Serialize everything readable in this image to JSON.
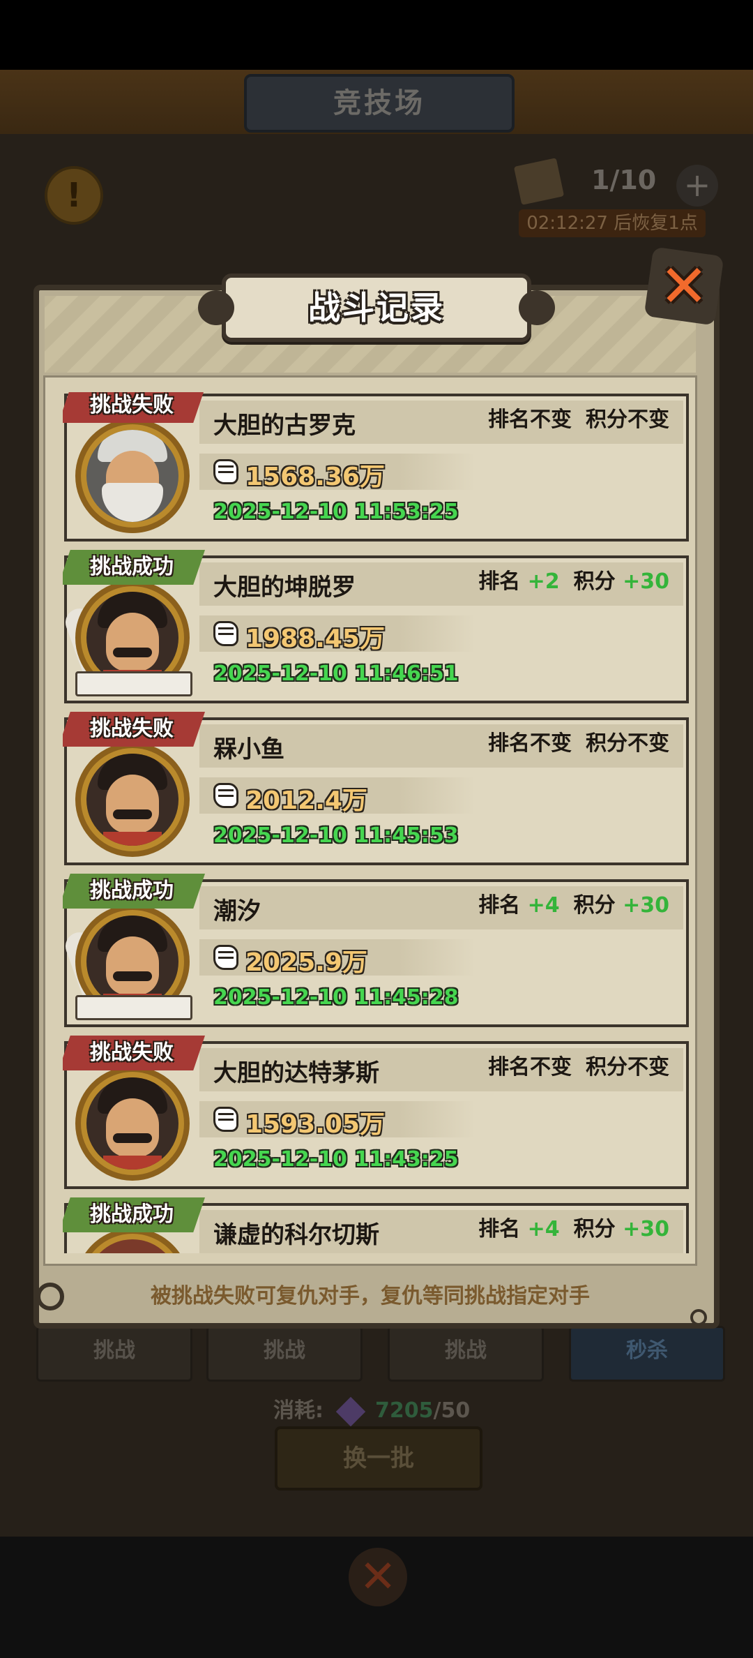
{
  "background": {
    "title": "竞技场",
    "info_icon_glyph": "!",
    "tickets": "1/10",
    "plus_glyph": "+",
    "recover_text": "02:12:27 后恢复1点",
    "buttons": [
      "挑战",
      "挑战",
      "挑战",
      "秒杀"
    ],
    "cost_label": "消耗:",
    "cost_have": "7205",
    "cost_need": "/50",
    "swap_label": "换一批",
    "close_glyph": "✕"
  },
  "modal": {
    "title": "战斗记录",
    "close_glyph": "✕",
    "footer": "被挑战失败可复仇对手，复仇等同挑战指定对手"
  },
  "records": [
    {
      "badge": "挑战失败",
      "outcome": "fail",
      "name": "大胆的古罗克",
      "result": "排名不变",
      "result2": "积分不变",
      "power": "1568.36万",
      "time": "2025-12-10 11:53:25",
      "avatar": "old-bearded-man"
    },
    {
      "badge": "挑战成功",
      "outcome": "win",
      "name": "大胆的坤脱罗",
      "rank_label": "排名",
      "rank_delta": "+2",
      "score_label": "积分",
      "score_delta": "+30",
      "power": "1988.45万",
      "time": "2025-12-10 11:46:51",
      "avatar": "mustache-man-quill"
    },
    {
      "badge": "挑战失败",
      "outcome": "fail",
      "name": "槑小鱼",
      "result": "排名不变",
      "result2": "积分不变",
      "power": "2012.4万",
      "time": "2025-12-10 11:45:53",
      "avatar": "mustache-man"
    },
    {
      "badge": "挑战成功",
      "outcome": "win",
      "name": "潮汐",
      "rank_label": "排名",
      "rank_delta": "+4",
      "score_label": "积分",
      "score_delta": "+30",
      "power": "2025.9万",
      "time": "2025-12-10 11:45:28",
      "avatar": "mustache-man-quill"
    },
    {
      "badge": "挑战失败",
      "outcome": "fail",
      "name": "大胆的达特茅斯",
      "result": "排名不变",
      "result2": "积分不变",
      "power": "1593.05万",
      "time": "2025-12-10 11:43:25",
      "avatar": "mustache-man"
    },
    {
      "badge": "挑战成功",
      "outcome": "win",
      "name": "谦虚的科尔切斯",
      "rank_label": "排名",
      "rank_delta": "+4",
      "score_label": "积分",
      "score_delta": "+30",
      "power": "",
      "time": "",
      "avatar": "red-hair-character"
    }
  ],
  "colors": {
    "fail_badge": "#a63a35",
    "win_badge": "#5f8f3b",
    "delta_green": "#34b43a",
    "time_green": "#46d650",
    "power_gold": "#f3c772"
  }
}
